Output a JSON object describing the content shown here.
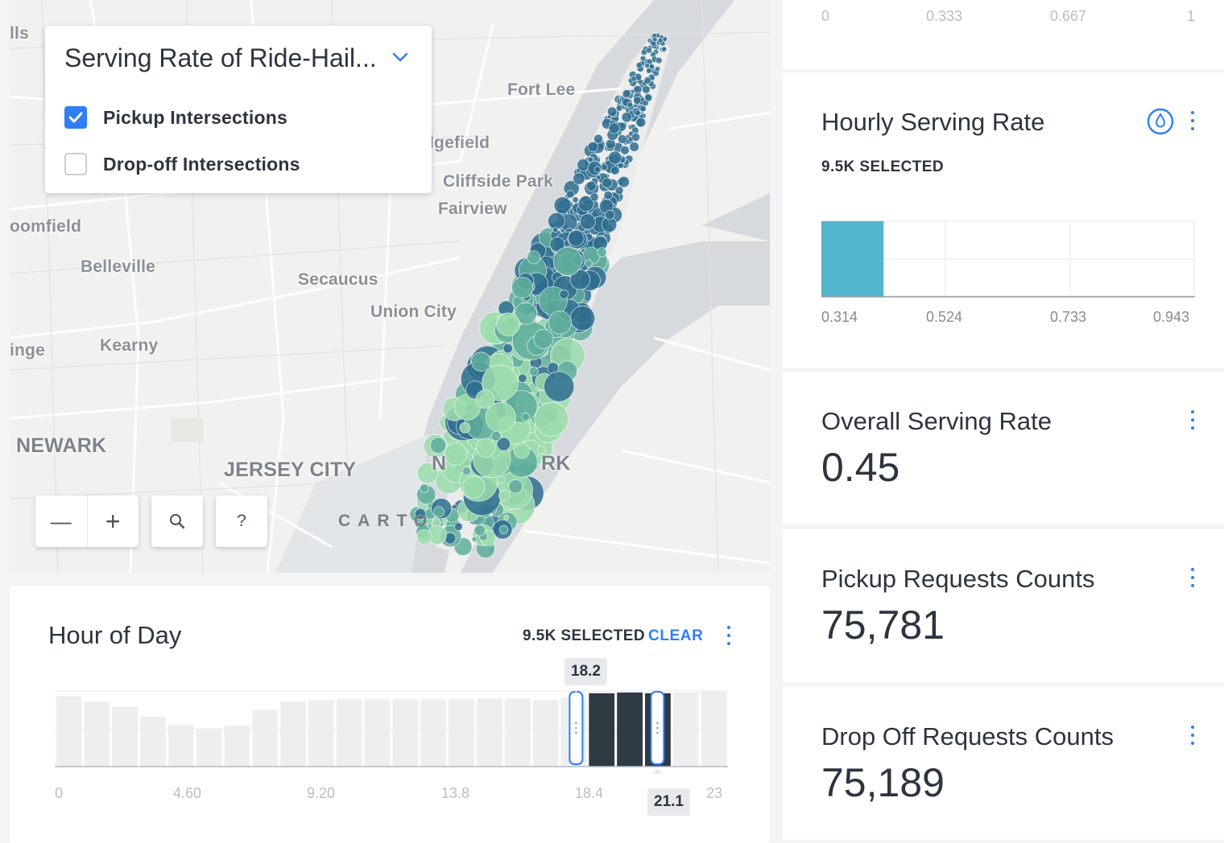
{
  "map": {
    "places": [
      {
        "name": "lls"
      },
      {
        "name": "Fort Lee"
      },
      {
        "name": "idgefield"
      },
      {
        "name": "Cliffside Park"
      },
      {
        "name": "Fairview"
      },
      {
        "name": "oomfield"
      },
      {
        "name": "Belleville"
      },
      {
        "name": "Secaucus"
      },
      {
        "name": "Union City"
      },
      {
        "name": "Kearny"
      },
      {
        "name": "inge"
      },
      {
        "name": "NEWARK"
      },
      {
        "name": "JERSEY CITY"
      },
      {
        "name": "N"
      },
      {
        "name": "RK"
      }
    ],
    "attribution": "CARTO",
    "layer_selector": {
      "title": "Serving Rate of Ride-Hail...",
      "options": [
        {
          "label": "Pickup Intersections",
          "checked": true
        },
        {
          "label": "Drop-off Intersections",
          "checked": false
        }
      ]
    },
    "controls": {
      "zoom_out": "—",
      "zoom_in": "+",
      "help": "?"
    },
    "colors": {
      "high": "#2f6d8f",
      "mid": "#5fad9c",
      "low": "#9bdcab"
    }
  },
  "top_partial_histogram": {
    "ticks": [
      "0",
      "0.333",
      "0.667",
      "1"
    ]
  },
  "hourly_serving_rate": {
    "title": "Hourly Serving Rate",
    "selected": "9.5K SELECTED",
    "ticks": [
      "0.314",
      "0.524",
      "0.733",
      "0.943"
    ],
    "bar_color": "#53b5cd"
  },
  "overall_serving_rate": {
    "title": "Overall Serving Rate",
    "value": "0.45"
  },
  "pickup_requests": {
    "title": "Pickup Requests Counts",
    "value": "75,781"
  },
  "dropoff_requests": {
    "title": "Drop Off Requests Counts",
    "value": "75,189"
  },
  "hour_of_day": {
    "title": "Hour of Day",
    "selected": "9.5K SELECTED",
    "clear": "CLEAR",
    "ticks": [
      "0",
      "4.60",
      "9.20",
      "13.8",
      "18.4",
      "23"
    ],
    "range_low": "18.2",
    "range_high": "21.1",
    "selected_hours": [
      19,
      20,
      21
    ],
    "bars": [
      0.93,
      0.86,
      0.79,
      0.66,
      0.55,
      0.49,
      0.54,
      0.75,
      0.86,
      0.88,
      0.89,
      0.89,
      0.89,
      0.89,
      0.89,
      0.9,
      0.9,
      0.88,
      0.91,
      0.97,
      0.98,
      0.97,
      0.98,
      0.99
    ],
    "colors": {
      "selected": "#2f3a43",
      "unselected": "#eeeeee",
      "handle": "#2f7ef5"
    }
  },
  "chart_data": [
    {
      "type": "bar",
      "title": "Hour of Day",
      "x": [
        0,
        1,
        2,
        3,
        4,
        5,
        6,
        7,
        8,
        9,
        10,
        11,
        12,
        13,
        14,
        15,
        16,
        17,
        18,
        19,
        20,
        21,
        22,
        23
      ],
      "xlim": [
        0,
        23
      ],
      "values": [
        0.93,
        0.86,
        0.79,
        0.66,
        0.55,
        0.49,
        0.54,
        0.75,
        0.86,
        0.88,
        0.89,
        0.89,
        0.89,
        0.89,
        0.89,
        0.9,
        0.9,
        0.88,
        0.91,
        0.97,
        0.98,
        0.97,
        0.98,
        0.99
      ],
      "selection": [
        18.2,
        21.1
      ]
    },
    {
      "type": "bar",
      "title": "Hourly Serving Rate",
      "x_ticks": [
        0.314,
        0.524,
        0.733,
        0.943
      ],
      "bins": [
        {
          "from": 0.314,
          "to": 0.419,
          "value": 1
        }
      ]
    }
  ]
}
